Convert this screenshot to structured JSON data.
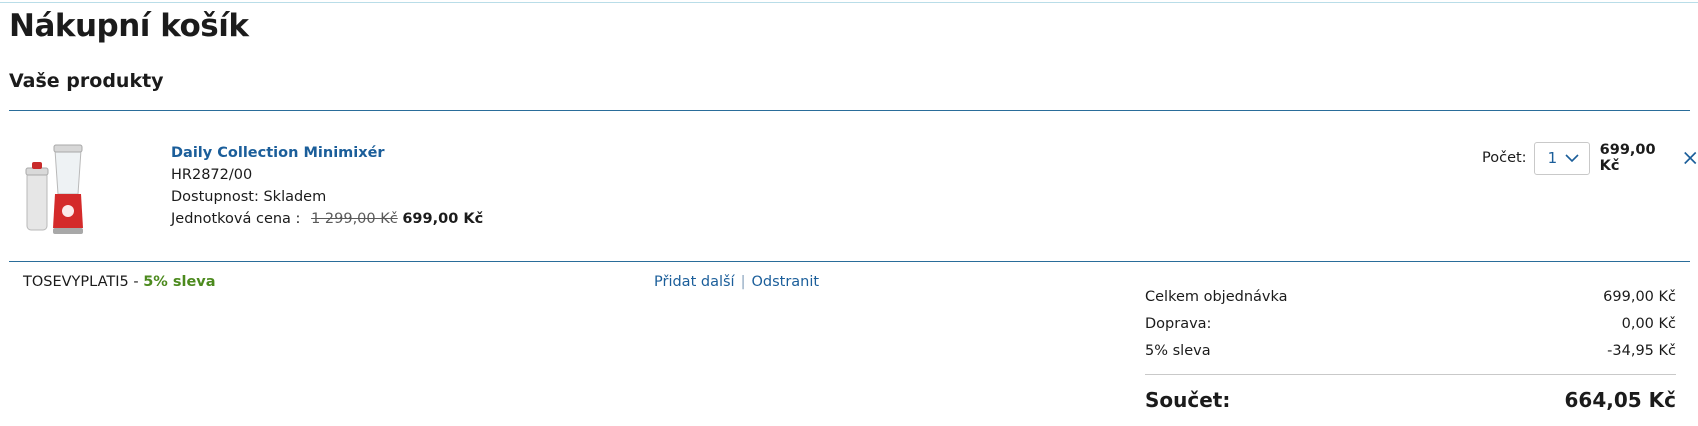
{
  "page": {
    "title": "Nákupní košík",
    "section_title": "Vaše produkty"
  },
  "product": {
    "name": "Daily Collection Minimixér",
    "sku": "HR2872/00",
    "availability": "Dostupnost: Skladem",
    "unit_price_label": "Jednotková cena :",
    "old_price": "1 299,00 Kč",
    "new_price": "699,00 Kč",
    "image_icon": "blender-product-image"
  },
  "quantity": {
    "label": "Počet:",
    "value": "1",
    "line_price": "699,00 Kč"
  },
  "coupon": {
    "code": "TOSEVYPLATI5",
    "separator": " - ",
    "discount": "5% sleva",
    "add_more": "Přidat další",
    "remove": "Odstranit"
  },
  "summary": {
    "order_total_label": "Celkem objednávka",
    "order_total_value": "699,00 Kč",
    "shipping_label": "Doprava:",
    "shipping_value": "0,00 Kč",
    "discount_label": "5% sleva",
    "discount_value": "-34,95 Kč",
    "grand_total_label": "Součet:",
    "grand_total_value": "664,05 Kč"
  },
  "colors": {
    "link": "#1b5e9a",
    "discount_green": "#4c8a1e",
    "rule": "#2a6d9a"
  }
}
